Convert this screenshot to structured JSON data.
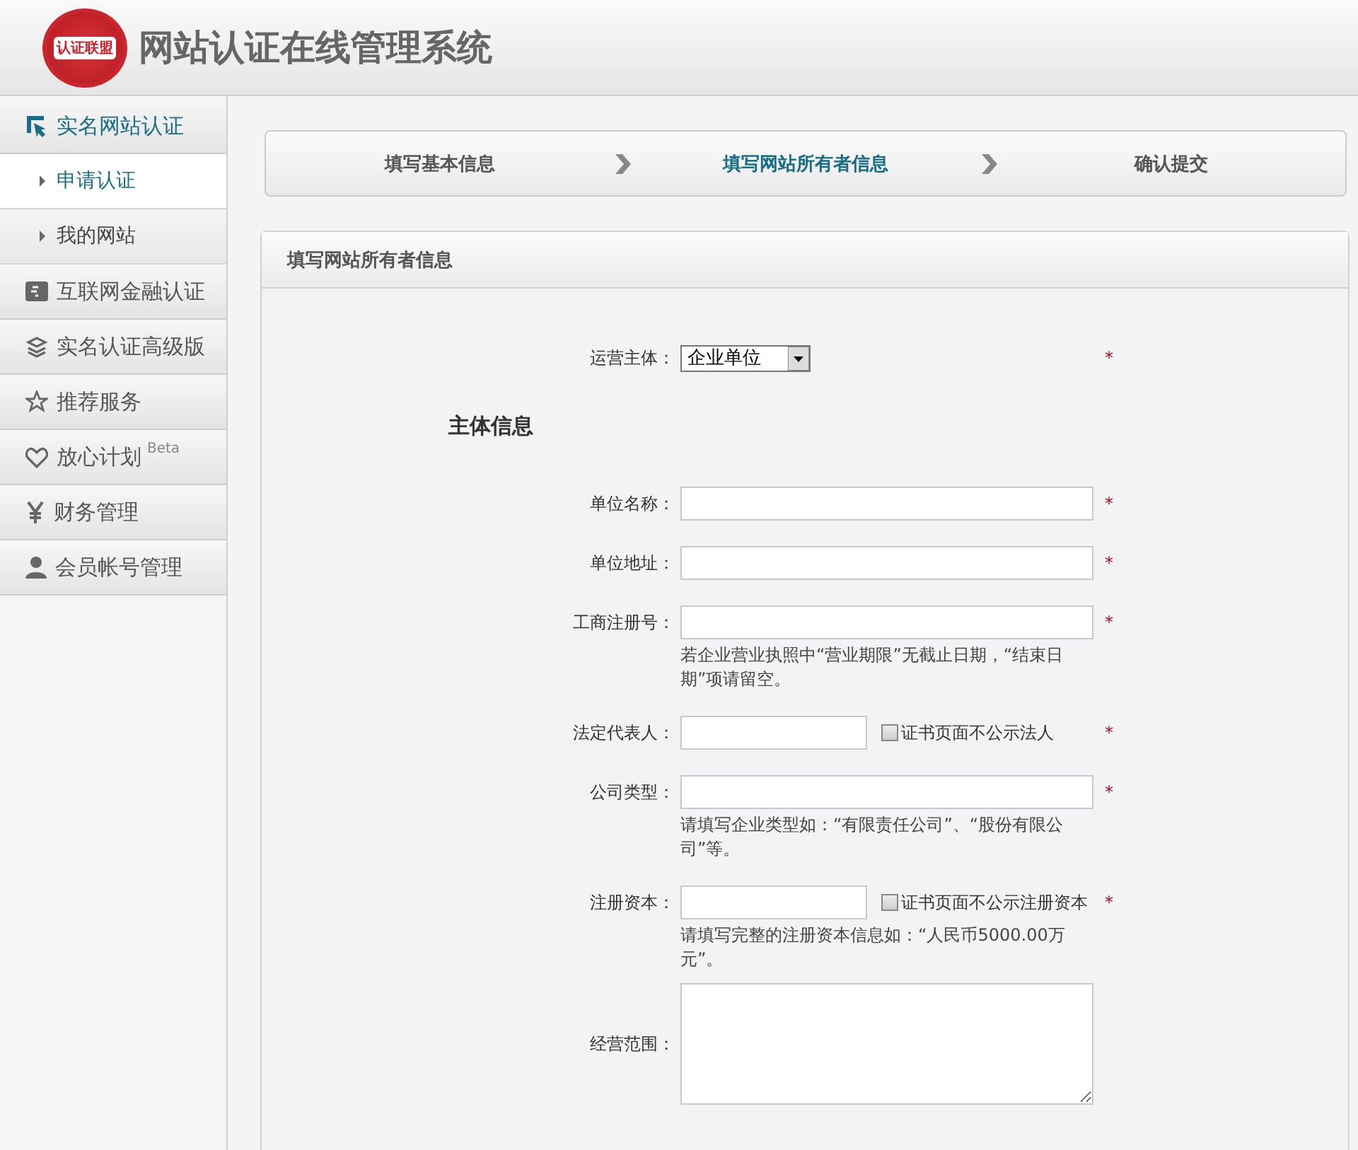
{
  "header": {
    "logo_text": "认证联盟",
    "title": "网站认证在线管理系统"
  },
  "sidebar": {
    "items": [
      {
        "label": "实名网站认证",
        "expanded": true,
        "children": [
          {
            "label": "申请认证",
            "selected": true
          },
          {
            "label": "我的网站",
            "selected": false
          }
        ]
      },
      {
        "label": "互联网金融认证",
        "expanded": false
      },
      {
        "label": "实名认证高级版",
        "expanded": false
      },
      {
        "label": "推荐服务",
        "expanded": false
      },
      {
        "label": "放心计划",
        "expanded": false,
        "badge": "Beta"
      },
      {
        "label": "财务管理",
        "expanded": false
      },
      {
        "label": "会员帐号管理",
        "expanded": false
      }
    ]
  },
  "steps": [
    {
      "label": "填写基本信息",
      "selected": false
    },
    {
      "label": "填写网站所有者信息",
      "selected": true
    },
    {
      "label": "确认提交",
      "selected": false
    }
  ],
  "panel": {
    "title": "填写网站所有者信息",
    "rows": [
      {
        "kind": "select",
        "label": "运营主体：",
        "value": "企业单位",
        "required_mark": "*"
      },
      {
        "kind": "heading",
        "label": "主体信息"
      },
      {
        "kind": "text",
        "label": "单位名称：",
        "required_mark": "*"
      },
      {
        "kind": "text",
        "label": "单位地址：",
        "required_mark": "*"
      },
      {
        "kind": "text",
        "label": "工商注册号：",
        "required_mark": "*",
        "hint": "若企业营业执照中“营业期限”无截止日期，“结束日期”项请留空。"
      },
      {
        "kind": "short",
        "label": "法定代表人：",
        "required_mark": "*",
        "checkbox": {
          "label": "证书页面不公示法人",
          "checked": false
        }
      },
      {
        "kind": "text",
        "label": "公司类型：",
        "required_mark": "*",
        "hint": "请填写企业类型如：“有限责任公司”、“股份有限公司”等。"
      },
      {
        "kind": "short",
        "label": "注册资本：",
        "required_mark": "*",
        "checkbox": {
          "label": "证书页面不公示注册资本",
          "checked": false
        },
        "hint": "请填写完整的注册资本信息如：“人民币5000.00万元”。"
      },
      {
        "kind": "textarea",
        "label": "经营范围："
      }
    ]
  }
}
